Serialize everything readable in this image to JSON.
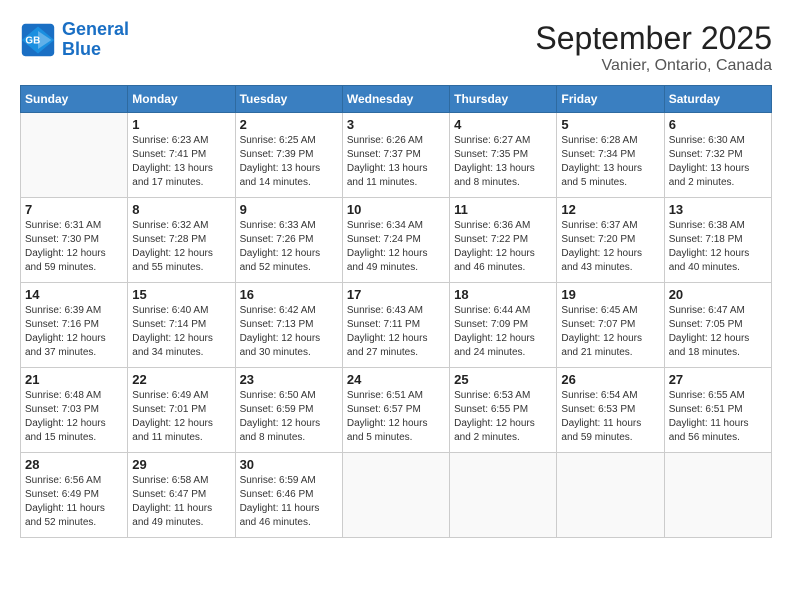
{
  "logo": {
    "line1": "General",
    "line2": "Blue"
  },
  "title": "September 2025",
  "subtitle": "Vanier, Ontario, Canada",
  "weekdays": [
    "Sunday",
    "Monday",
    "Tuesday",
    "Wednesday",
    "Thursday",
    "Friday",
    "Saturday"
  ],
  "weeks": [
    [
      {
        "day": "",
        "empty": true
      },
      {
        "day": "1",
        "sunrise": "6:23 AM",
        "sunset": "7:41 PM",
        "daylight": "13 hours and 17 minutes."
      },
      {
        "day": "2",
        "sunrise": "6:25 AM",
        "sunset": "7:39 PM",
        "daylight": "13 hours and 14 minutes."
      },
      {
        "day": "3",
        "sunrise": "6:26 AM",
        "sunset": "7:37 PM",
        "daylight": "13 hours and 11 minutes."
      },
      {
        "day": "4",
        "sunrise": "6:27 AM",
        "sunset": "7:35 PM",
        "daylight": "13 hours and 8 minutes."
      },
      {
        "day": "5",
        "sunrise": "6:28 AM",
        "sunset": "7:34 PM",
        "daylight": "13 hours and 5 minutes."
      },
      {
        "day": "6",
        "sunrise": "6:30 AM",
        "sunset": "7:32 PM",
        "daylight": "13 hours and 2 minutes."
      }
    ],
    [
      {
        "day": "7",
        "sunrise": "6:31 AM",
        "sunset": "7:30 PM",
        "daylight": "12 hours and 59 minutes."
      },
      {
        "day": "8",
        "sunrise": "6:32 AM",
        "sunset": "7:28 PM",
        "daylight": "12 hours and 55 minutes."
      },
      {
        "day": "9",
        "sunrise": "6:33 AM",
        "sunset": "7:26 PM",
        "daylight": "12 hours and 52 minutes."
      },
      {
        "day": "10",
        "sunrise": "6:34 AM",
        "sunset": "7:24 PM",
        "daylight": "12 hours and 49 minutes."
      },
      {
        "day": "11",
        "sunrise": "6:36 AM",
        "sunset": "7:22 PM",
        "daylight": "12 hours and 46 minutes."
      },
      {
        "day": "12",
        "sunrise": "6:37 AM",
        "sunset": "7:20 PM",
        "daylight": "12 hours and 43 minutes."
      },
      {
        "day": "13",
        "sunrise": "6:38 AM",
        "sunset": "7:18 PM",
        "daylight": "12 hours and 40 minutes."
      }
    ],
    [
      {
        "day": "14",
        "sunrise": "6:39 AM",
        "sunset": "7:16 PM",
        "daylight": "12 hours and 37 minutes."
      },
      {
        "day": "15",
        "sunrise": "6:40 AM",
        "sunset": "7:14 PM",
        "daylight": "12 hours and 34 minutes."
      },
      {
        "day": "16",
        "sunrise": "6:42 AM",
        "sunset": "7:13 PM",
        "daylight": "12 hours and 30 minutes."
      },
      {
        "day": "17",
        "sunrise": "6:43 AM",
        "sunset": "7:11 PM",
        "daylight": "12 hours and 27 minutes."
      },
      {
        "day": "18",
        "sunrise": "6:44 AM",
        "sunset": "7:09 PM",
        "daylight": "12 hours and 24 minutes."
      },
      {
        "day": "19",
        "sunrise": "6:45 AM",
        "sunset": "7:07 PM",
        "daylight": "12 hours and 21 minutes."
      },
      {
        "day": "20",
        "sunrise": "6:47 AM",
        "sunset": "7:05 PM",
        "daylight": "12 hours and 18 minutes."
      }
    ],
    [
      {
        "day": "21",
        "sunrise": "6:48 AM",
        "sunset": "7:03 PM",
        "daylight": "12 hours and 15 minutes."
      },
      {
        "day": "22",
        "sunrise": "6:49 AM",
        "sunset": "7:01 PM",
        "daylight": "12 hours and 11 minutes."
      },
      {
        "day": "23",
        "sunrise": "6:50 AM",
        "sunset": "6:59 PM",
        "daylight": "12 hours and 8 minutes."
      },
      {
        "day": "24",
        "sunrise": "6:51 AM",
        "sunset": "6:57 PM",
        "daylight": "12 hours and 5 minutes."
      },
      {
        "day": "25",
        "sunrise": "6:53 AM",
        "sunset": "6:55 PM",
        "daylight": "12 hours and 2 minutes."
      },
      {
        "day": "26",
        "sunrise": "6:54 AM",
        "sunset": "6:53 PM",
        "daylight": "11 hours and 59 minutes."
      },
      {
        "day": "27",
        "sunrise": "6:55 AM",
        "sunset": "6:51 PM",
        "daylight": "11 hours and 56 minutes."
      }
    ],
    [
      {
        "day": "28",
        "sunrise": "6:56 AM",
        "sunset": "6:49 PM",
        "daylight": "11 hours and 52 minutes."
      },
      {
        "day": "29",
        "sunrise": "6:58 AM",
        "sunset": "6:47 PM",
        "daylight": "11 hours and 49 minutes."
      },
      {
        "day": "30",
        "sunrise": "6:59 AM",
        "sunset": "6:46 PM",
        "daylight": "11 hours and 46 minutes."
      },
      {
        "day": "",
        "empty": true
      },
      {
        "day": "",
        "empty": true
      },
      {
        "day": "",
        "empty": true
      },
      {
        "day": "",
        "empty": true
      }
    ]
  ]
}
